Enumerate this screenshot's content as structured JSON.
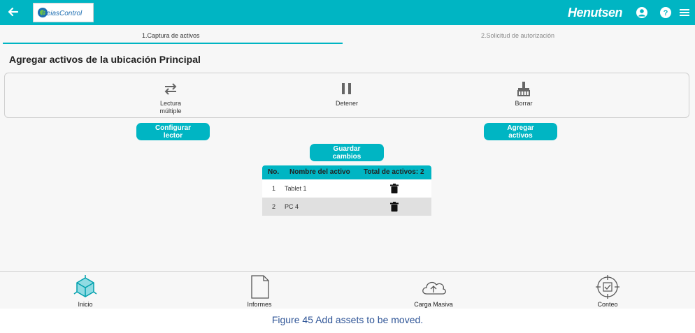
{
  "header": {
    "logo_text": "BeiasControl",
    "brand": "Henutsen"
  },
  "steps": [
    {
      "label": "1.Captura de activos"
    },
    {
      "label": "2.Solicitud de autorización"
    }
  ],
  "page_title": "Agregar activos de la ubicación Principal",
  "actions": {
    "multi_read_line1": "Lectura",
    "multi_read_line2": "múltiple",
    "stop": "Detener",
    "clear": "Borrar"
  },
  "buttons": {
    "config_line1": "Configurar",
    "config_line2": "lector",
    "add_line1": "Agregar",
    "add_line2": "activos",
    "save_line1": "Guardar",
    "save_line2": "cambios"
  },
  "table": {
    "col_no": "No.",
    "col_name": "Nombre del activo",
    "col_total": "Total de activos: 2",
    "rows": [
      {
        "no": "1",
        "name": "Tablet 1"
      },
      {
        "no": "2",
        "name": "PC 4"
      }
    ]
  },
  "nav": {
    "home": "Inicio",
    "reports": "Informes",
    "bulk": "Carga Masiva",
    "count": "Conteo"
  },
  "caption": "Figure 45 Add assets to be moved.",
  "colors": {
    "accent": "#00b5c3",
    "caption": "#2f5597"
  }
}
